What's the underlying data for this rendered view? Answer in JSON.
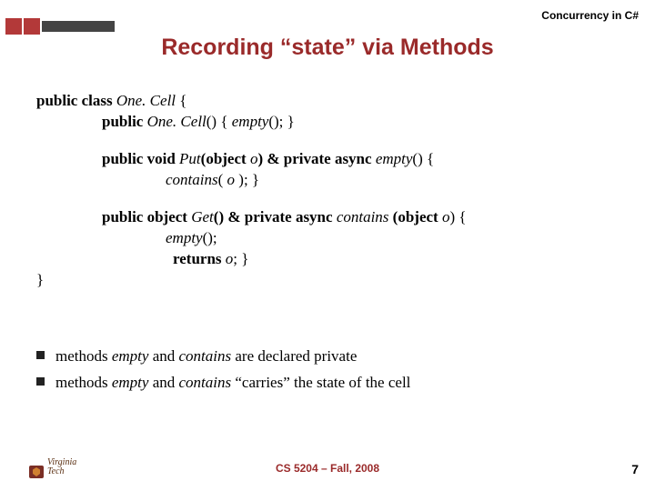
{
  "header": {
    "label": "Concurrency in C#"
  },
  "title": "Recording “state” via Methods",
  "code": {
    "l1a": "public class ",
    "l1b": "One. Cell",
    "l1c": " {",
    "l2a": "public ",
    "l2b": "One. Cell",
    "l2c": "() { ",
    "l2d": "empty",
    "l2e": "(); }",
    "l3a": "public void ",
    "l3b": "Put",
    "l3c": "(object ",
    "l3d": "o",
    "l3e": ") & private async ",
    "l3f": "empty",
    "l3g": "() {",
    "l4a": "contains",
    "l4b": "( ",
    "l4c": "o",
    "l4d": " ); }",
    "l5a": "public object ",
    "l5b": "Get",
    "l5c": "() & private async ",
    "l5d": "contains ",
    "l5e": "(object ",
    "l5f": "o",
    "l5g": ") {",
    "l6a": "empty",
    "l6b": "();",
    "l7a": "returns ",
    "l7b": "o",
    "l7c": "; }",
    "l8": "}"
  },
  "bullets": {
    "b1a": "methods ",
    "b1b": "empty",
    "b1c": " and ",
    "b1d": "contains",
    "b1e": " are declared private",
    "b2a": "methods ",
    "b2b": "empty",
    "b2c": " and ",
    "b2d": "contains",
    "b2e": " “carries” the state of the cell"
  },
  "footer": {
    "course": "CS 5204 – Fall, 2008",
    "page": "7",
    "logo_line1": "Virginia",
    "logo_line2": "Tech"
  }
}
